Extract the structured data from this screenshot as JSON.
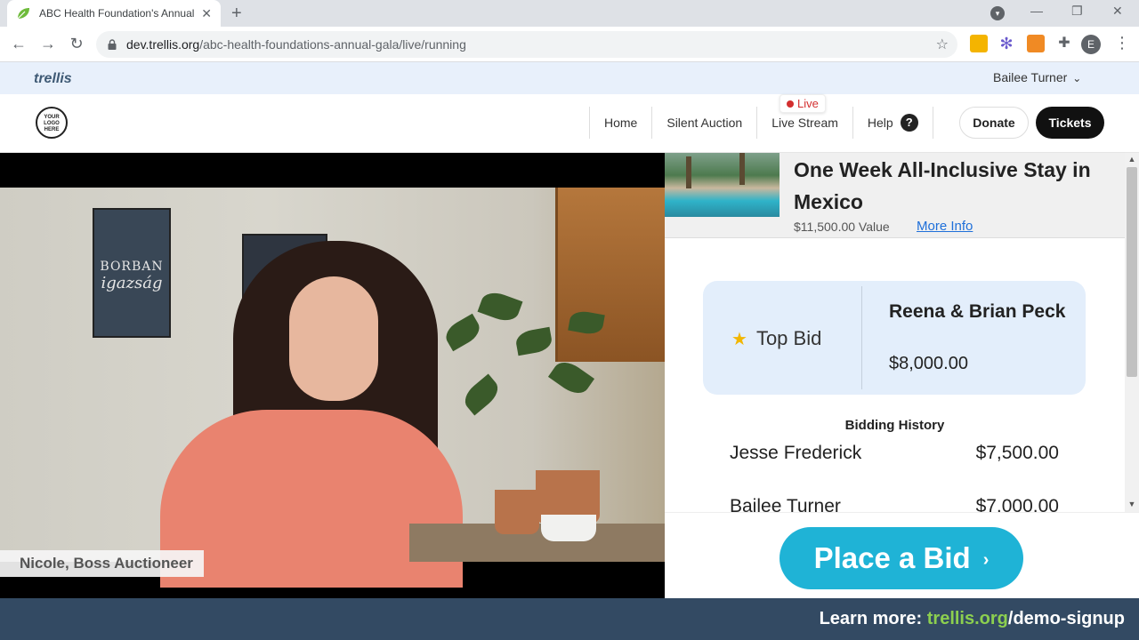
{
  "browser": {
    "tab_title": "ABC Health Foundation's Annual",
    "url_host": "dev.trellis.org",
    "url_path": "/abc-health-foundations-annual-gala/live/running",
    "avatar_letter": "E"
  },
  "site": {
    "brand": "trellis",
    "user_name": "Bailee Turner",
    "logo_text": "YOUR LOGO HERE",
    "nav": {
      "home": "Home",
      "silent_auction": "Silent Auction",
      "live_stream": "Live Stream",
      "help": "Help",
      "live_badge": "Live"
    },
    "donate_label": "Donate",
    "tickets_label": "Tickets"
  },
  "video": {
    "caption": "Nicole, Boss Auctioneer",
    "poster1_line1": "BORBAN",
    "poster1_line2": "igazság"
  },
  "item": {
    "title": "One Week All-Inclusive Stay in Mexico",
    "value": "$11,500.00 Value",
    "more_info": "More Info"
  },
  "top_bid": {
    "label": "Top Bid",
    "name": "Reena & Brian Peck",
    "amount": "$8,000.00"
  },
  "history": {
    "title": "Bidding History",
    "rows": [
      {
        "name": "Jesse Frederick",
        "amount": "$7,500.00"
      },
      {
        "name": "Bailee Turner",
        "amount": "$7,000.00"
      }
    ]
  },
  "bid_button": "Place a Bid",
  "footer": {
    "prefix": "Learn more: ",
    "link": "trellis.org",
    "suffix": "/demo-signup"
  },
  "colors": {
    "accent_blue": "#1fb3d6",
    "footer_bg": "#334a63",
    "link_green": "#8ccf4f",
    "live_red": "#d32f2f"
  }
}
